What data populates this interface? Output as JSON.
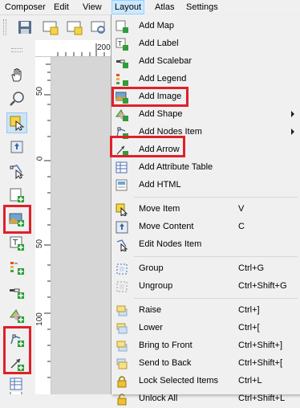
{
  "menubar": {
    "items": [
      {
        "label": "Composer"
      },
      {
        "label": "Edit"
      },
      {
        "label": "View"
      },
      {
        "label": "Layout"
      },
      {
        "label": "Atlas"
      },
      {
        "label": "Settings"
      }
    ],
    "active": "Layout"
  },
  "toolbar": {
    "buttons": [
      {
        "icon": "save-icon"
      },
      {
        "icon": "new-composer-icon"
      },
      {
        "icon": "duplicate-composer-icon"
      },
      {
        "icon": "composer-manager-icon"
      }
    ]
  },
  "left_toolbar": {
    "buttons": [
      {
        "icon": "pan-icon"
      },
      {
        "icon": "zoom-icon"
      },
      {
        "icon": "select-move-item-icon",
        "selected": true
      },
      {
        "icon": "move-content-icon"
      },
      {
        "icon": "edit-nodes-icon"
      },
      {
        "icon": "add-map-icon"
      },
      {
        "icon": "add-image-icon",
        "highlighted": true
      },
      {
        "icon": "add-label-icon"
      },
      {
        "icon": "add-legend-icon"
      },
      {
        "icon": "add-scalebar-icon"
      },
      {
        "icon": "add-shape-icon"
      },
      {
        "icon": "add-nodes-icon"
      },
      {
        "icon": "add-arrow-icon",
        "highlighted": true
      },
      {
        "icon": "add-attribute-table-icon"
      },
      {
        "icon": "add-html-icon"
      }
    ]
  },
  "rulers": {
    "horizontal_label": "200",
    "vertical_labels": [
      "50",
      "0",
      "50",
      "100"
    ]
  },
  "layout_menu": {
    "groups": [
      [
        {
          "label": "Add Map",
          "icon": "add-map-icon"
        },
        {
          "label": "Add Label",
          "icon": "add-label-icon"
        },
        {
          "label": "Add Scalebar",
          "icon": "add-scalebar-icon"
        },
        {
          "label": "Add Legend",
          "icon": "add-legend-icon"
        },
        {
          "label": "Add Image",
          "icon": "add-image-icon",
          "highlighted": true
        },
        {
          "label": "Add Shape",
          "icon": "add-shape-icon",
          "submenu": true
        },
        {
          "label": "Add Nodes Item",
          "icon": "add-nodes-icon",
          "submenu": true
        },
        {
          "label": "Add Arrow",
          "icon": "add-arrow-icon",
          "highlighted": true
        },
        {
          "label": "Add Attribute Table",
          "icon": "add-attribute-table-icon"
        },
        {
          "label": "Add HTML",
          "icon": "add-html-icon"
        }
      ],
      [
        {
          "label": "Move Item",
          "icon": "move-item-icon",
          "shortcut": "V"
        },
        {
          "label": "Move Content",
          "icon": "move-content-icon",
          "shortcut": "C"
        },
        {
          "label": "Edit Nodes Item",
          "icon": "edit-nodes-icon"
        }
      ],
      [
        {
          "label": "Group",
          "icon": "group-icon",
          "shortcut": "Ctrl+G"
        },
        {
          "label": "Ungroup",
          "icon": "ungroup-icon",
          "shortcut": "Ctrl+Shift+G"
        }
      ],
      [
        {
          "label": "Raise",
          "icon": "raise-icon",
          "shortcut": "Ctrl+]"
        },
        {
          "label": "Lower",
          "icon": "lower-icon",
          "shortcut": "Ctrl+["
        },
        {
          "label": "Bring to Front",
          "icon": "bring-to-front-icon",
          "shortcut": "Ctrl+Shift+]"
        },
        {
          "label": "Send to Back",
          "icon": "send-to-back-icon",
          "shortcut": "Ctrl+Shift+["
        },
        {
          "label": "Lock Selected Items",
          "icon": "lock-icon",
          "shortcut": "Ctrl+L"
        },
        {
          "label": "Unlock All",
          "icon": "unlock-icon",
          "shortcut": "Ctrl+Shift+L"
        }
      ]
    ]
  },
  "colors": {
    "highlight_box": "#e0202a",
    "menu_active_bg": "#cce8ff",
    "menu_active_border": "#99d1ff"
  }
}
